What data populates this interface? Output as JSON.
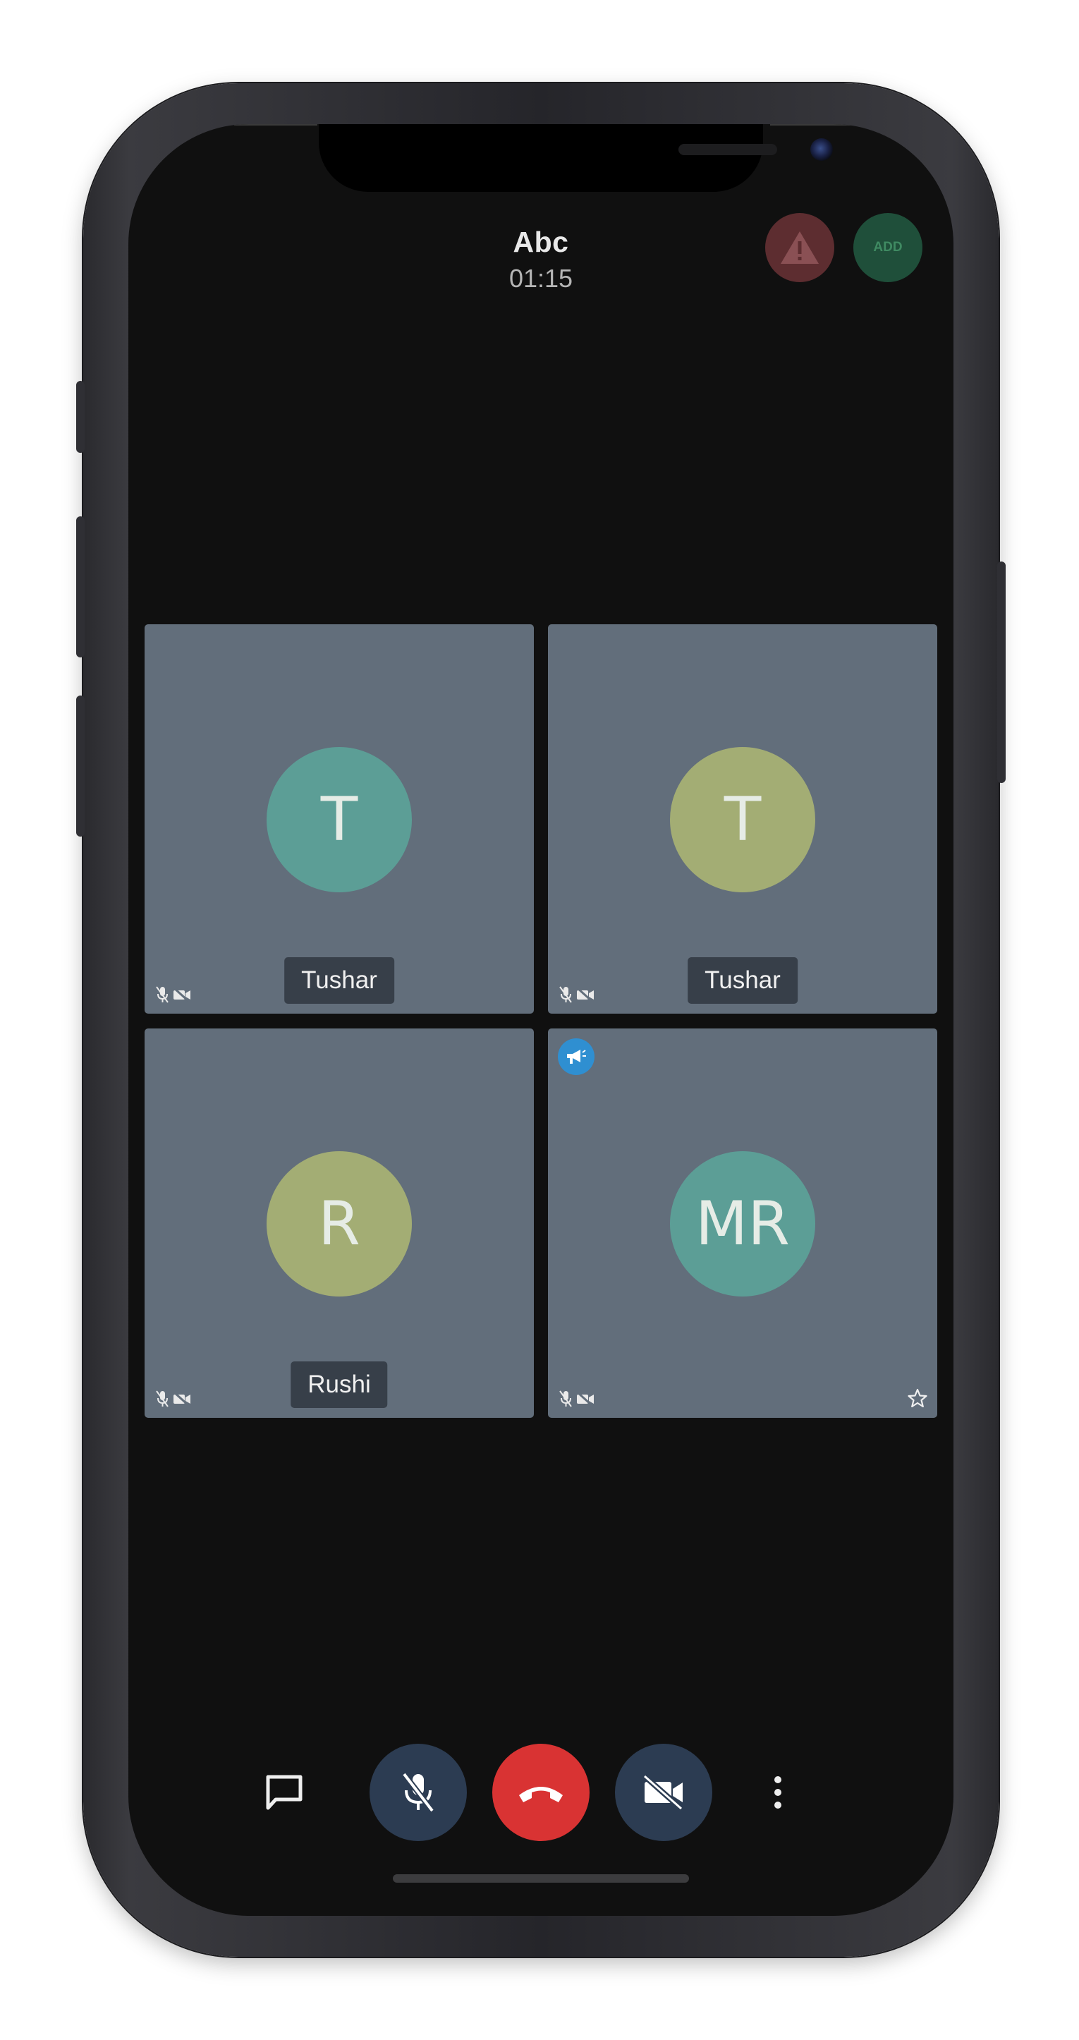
{
  "call": {
    "title": "Abc",
    "duration": "01:15"
  },
  "header_buttons": {
    "report_icon": "warning-icon",
    "add_label": "ADD",
    "report_color": "#5d2d30",
    "add_color": "#1f4f3a"
  },
  "participants": [
    {
      "initials": "T",
      "name": "Tushar",
      "avatar_color": "#5c9e96",
      "host": false,
      "starred": false
    },
    {
      "initials": "T",
      "name": "Tushar",
      "avatar_color": "#a3ad74",
      "host": false,
      "starred": false
    },
    {
      "initials": "R",
      "name": "Rushi",
      "avatar_color": "#a3ad74",
      "host": false,
      "starred": false
    },
    {
      "initials": "MR",
      "name": "",
      "avatar_color": "#5c9e96",
      "host": true,
      "starred": true
    }
  ],
  "tile_status_icons": [
    "mic-off-icon",
    "video-off-icon"
  ],
  "controls": {
    "chat_icon": "chat-bubble-icon",
    "mic_icon": "mic-off-icon",
    "end_call_icon": "phone-hangup-icon",
    "camera_icon": "video-off-icon",
    "more_icon": "more-vertical-icon",
    "end_call_color": "#d93333",
    "toggle_color": "#2c3c52"
  },
  "colors": {
    "background": "#101010",
    "tile": "#626e7b",
    "name_tag": "#373f49",
    "host_badge": "#2f8fd1"
  }
}
